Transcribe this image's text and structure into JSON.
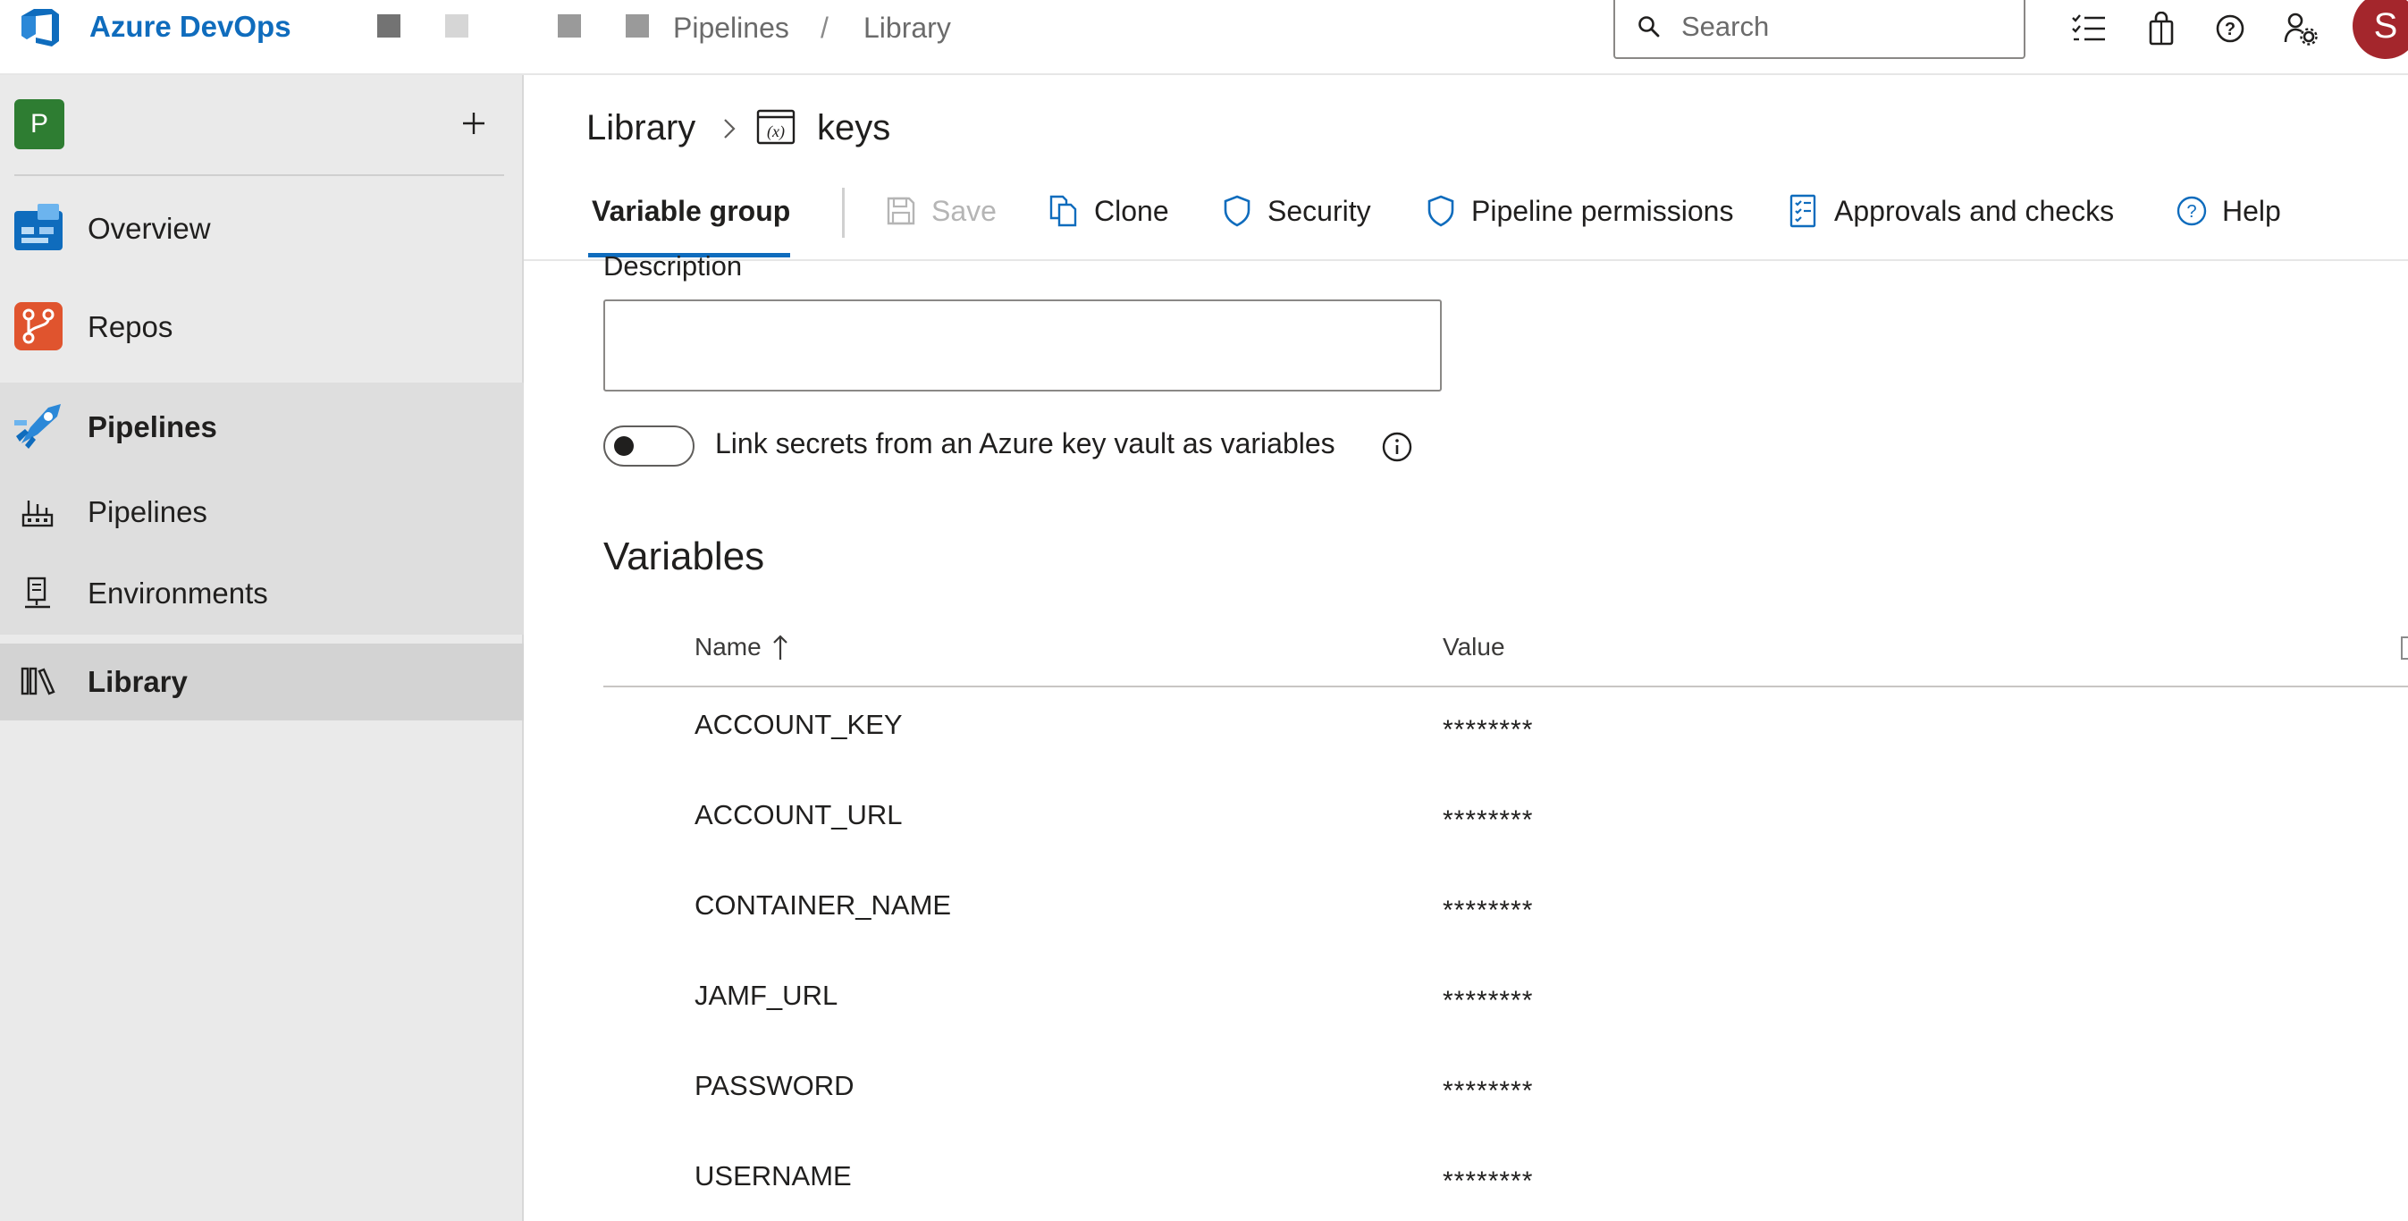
{
  "header": {
    "brand": "Azure DevOps",
    "breadcrumb": [
      "Pipelines",
      "Library"
    ],
    "breadcrumb_separator": "/",
    "search_placeholder": "Search",
    "icons": [
      "task-list-icon",
      "shopping-bag-icon",
      "help-icon",
      "user-settings-icon"
    ],
    "avatar_initial": "S"
  },
  "sidebar": {
    "project_initial": "P",
    "items": [
      {
        "label": "Overview",
        "icon": "overview-icon"
      },
      {
        "label": "Repos",
        "icon": "repos-icon"
      },
      {
        "label": "Pipelines",
        "icon": "pipelines-section-icon"
      },
      {
        "label": "Pipelines",
        "icon": "pipelines-icon"
      },
      {
        "label": "Environments",
        "icon": "environments-icon"
      },
      {
        "label": "Library",
        "icon": "library-icon"
      }
    ]
  },
  "page": {
    "breadcrumb_root": "Library",
    "group_name": "keys"
  },
  "toolbar": {
    "active_tab": "Variable group",
    "save": "Save",
    "clone": "Clone",
    "security": "Security",
    "pipeline_permissions": "Pipeline permissions",
    "approvals": "Approvals and checks",
    "help": "Help"
  },
  "form": {
    "description_label": "Description",
    "description_value": "",
    "keyvault_toggle_label": "Link secrets from an Azure key vault as variables"
  },
  "variables": {
    "title": "Variables",
    "columns": {
      "name": "Name",
      "value": "Value"
    },
    "rows": [
      {
        "name": "ACCOUNT_KEY",
        "value": "********"
      },
      {
        "name": "ACCOUNT_URL",
        "value": "********"
      },
      {
        "name": "CONTAINER_NAME",
        "value": "********"
      },
      {
        "name": "JAMF_URL",
        "value": "********"
      },
      {
        "name": "PASSWORD",
        "value": "********"
      },
      {
        "name": "USERNAME",
        "value": "********"
      }
    ]
  },
  "colors": {
    "brand_blue": "#0f6cbd",
    "avatar_red": "#a4262c",
    "project_green": "#2e7d32",
    "sidebar_bg": "#eaeaea"
  }
}
